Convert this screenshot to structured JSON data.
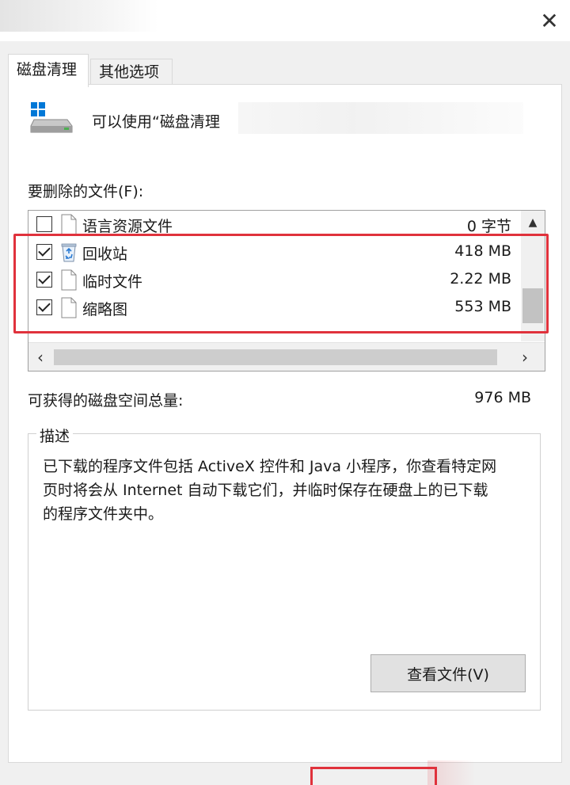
{
  "window": {
    "close_glyph": "✕"
  },
  "tabs": [
    {
      "label": "磁盘清理",
      "active": true
    },
    {
      "label": "其他选项",
      "active": false
    }
  ],
  "header": {
    "text": "可以使用“磁盘清理",
    "icon": "drive-icon"
  },
  "files": {
    "label": "要删除的文件(F):",
    "rows": [
      {
        "checked": false,
        "icon": "file-icon",
        "name": "语言资源文件",
        "size": "0 字节"
      },
      {
        "checked": true,
        "icon": "recycle-bin-icon",
        "name": "回收站",
        "size": "418 MB"
      },
      {
        "checked": true,
        "icon": "file-icon",
        "name": "临时文件",
        "size": "2.22 MB"
      },
      {
        "checked": true,
        "icon": "file-icon",
        "name": "缩略图",
        "size": "553 MB"
      }
    ]
  },
  "total": {
    "label": "可获得的磁盘空间总量:",
    "value": "976 MB"
  },
  "description": {
    "legend": "描述",
    "line1": "已下载的程序文件包括 ActiveX 控件和 Java 小程序，你查看特定网",
    "line2": "页时将会从 Internet 自动下载它们，并临时保存在硬盘上的已下载",
    "line3": "的程序文件夹中。"
  },
  "buttons": {
    "view_files": "查看文件(V)"
  },
  "colors": {
    "highlight": "#e0323c",
    "accent": "#0078d7"
  }
}
